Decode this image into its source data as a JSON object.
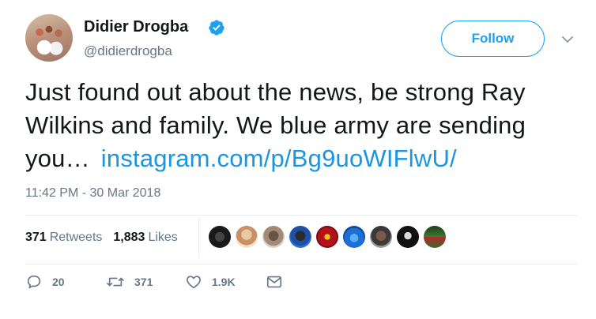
{
  "author": {
    "name": "Didier Drogba",
    "handle": "@didierdrogba"
  },
  "follow_label": "Follow",
  "tweet": {
    "text": "Just found out about the news, be strong Ray Wilkins and family. We blue army are sending you…",
    "link": "instagram.com/p/Bg9uoWIFlwU/"
  },
  "timestamp": "11:42 PM - 30 Mar 2018",
  "stats": {
    "retweets_count": "371",
    "retweets_label": "Retweets",
    "likes_count": "1,883",
    "likes_label": "Likes"
  },
  "actions": {
    "replies": "20",
    "retweets": "371",
    "likes": "1.9K"
  },
  "colors": {
    "accent": "#1da1f2",
    "link": "#1b95e0",
    "muted": "#657786"
  }
}
